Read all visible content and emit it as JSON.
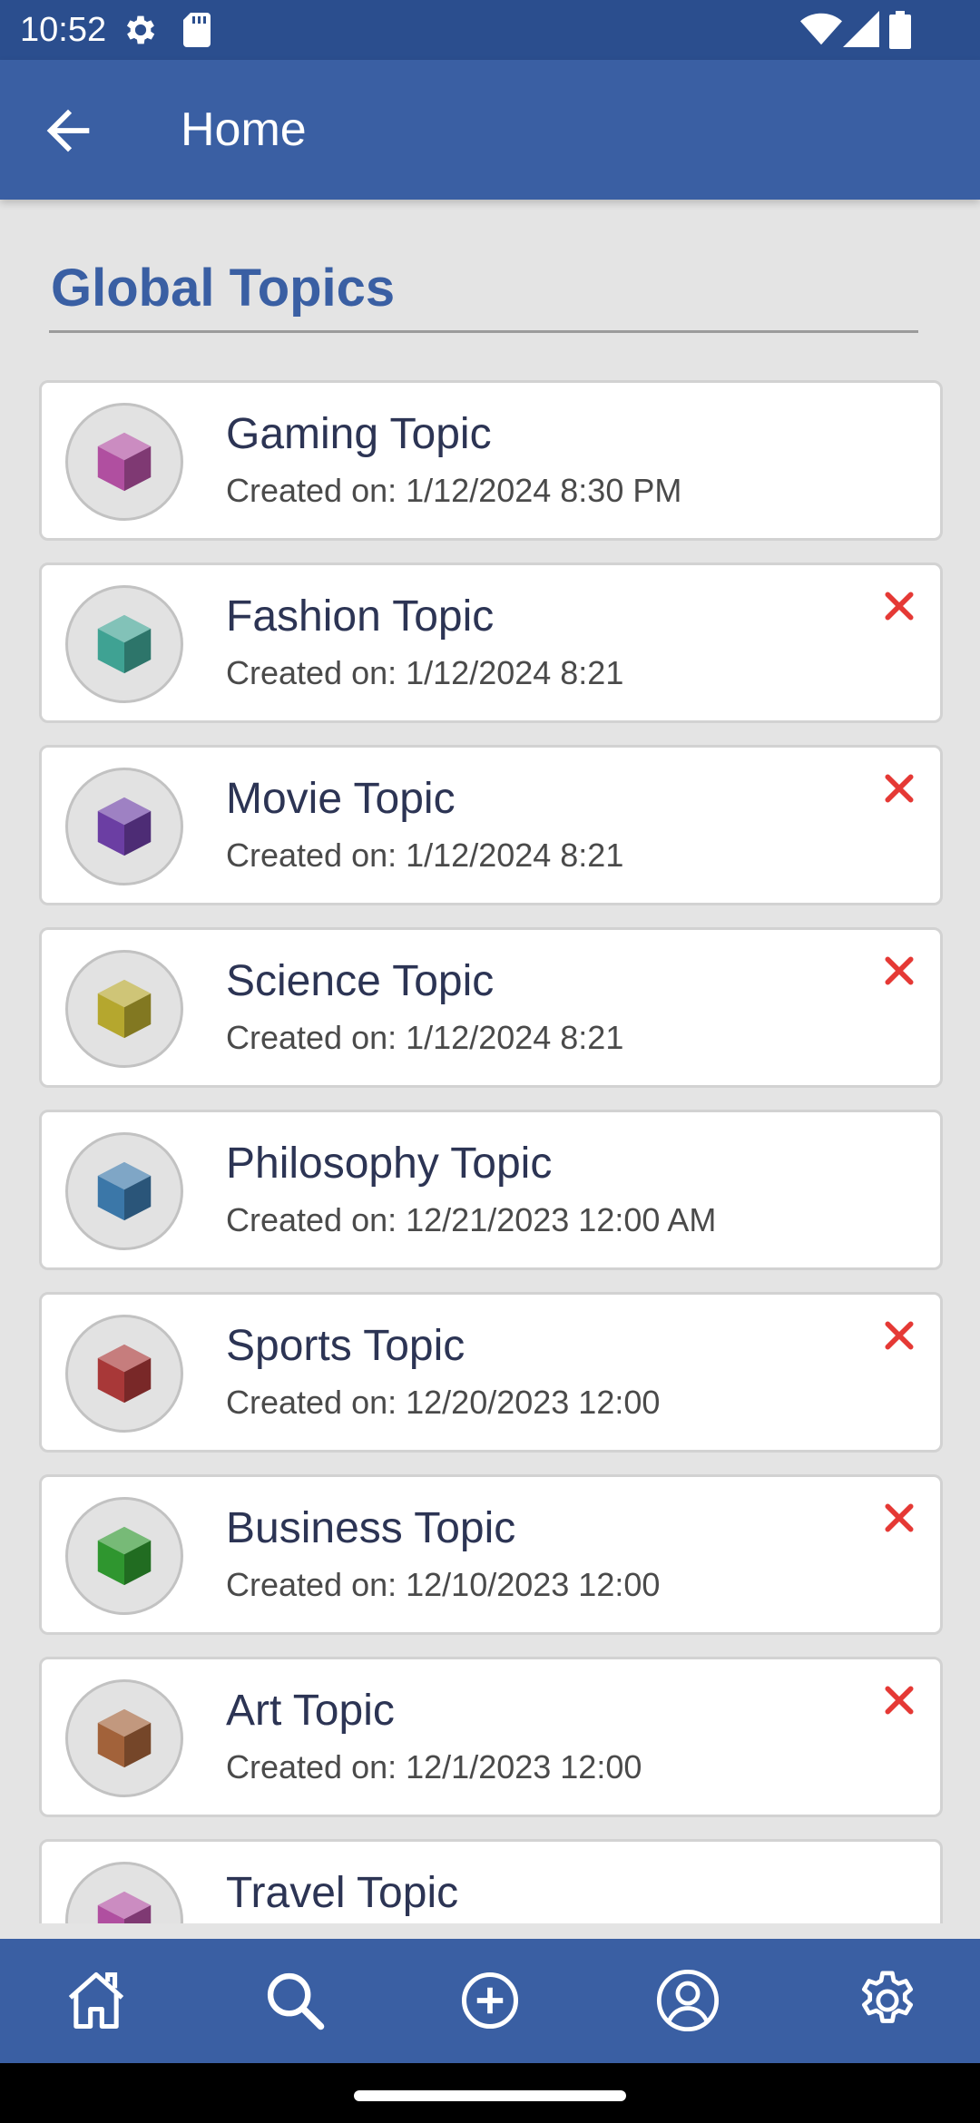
{
  "status_bar": {
    "time": "10:52",
    "icons": [
      "settings-gear-icon",
      "sd-card-icon",
      "wifi-icon",
      "signal-icon",
      "battery-icon"
    ]
  },
  "app_bar": {
    "title": "Home",
    "back_icon": "arrow-back-icon"
  },
  "section": {
    "title": "Global Topics"
  },
  "topics": [
    {
      "name": "Gaming Topic",
      "date": "Created on: 1/12/2024 8:30 PM",
      "color": "#b04fa0",
      "deletable": false
    },
    {
      "name": "Fashion Topic",
      "date": "Created on: 1/12/2024 8:21",
      "color": "#3fa293",
      "deletable": true
    },
    {
      "name": "Movie Topic",
      "date": "Created on: 1/12/2024 8:21",
      "color": "#6b3ea3",
      "deletable": true
    },
    {
      "name": "Science Topic",
      "date": "Created on: 1/12/2024 8:21",
      "color": "#b5a72e",
      "deletable": true
    },
    {
      "name": "Philosophy Topic",
      "date": "Created on: 12/21/2023 12:00 AM",
      "color": "#3b77a8",
      "deletable": false
    },
    {
      "name": "Sports Topic",
      "date": "Created on: 12/20/2023 12:00",
      "color": "#a83838",
      "deletable": true
    },
    {
      "name": "Business Topic",
      "date": "Created on: 12/10/2023 12:00",
      "color": "#2f962f",
      "deletable": true
    },
    {
      "name": "Art Topic",
      "date": "Created on: 12/1/2023 12:00",
      "color": "#a2623a",
      "deletable": true
    },
    {
      "name": "Travel Topic",
      "date": "",
      "color": "#b04fa0",
      "deletable": false
    }
  ],
  "bottom_nav": {
    "items": [
      "home-icon",
      "search-icon",
      "add-circle-icon",
      "profile-icon",
      "settings-icon"
    ]
  },
  "colors": {
    "primary": "#3a5fa3",
    "status_bar": "#2b4e8e",
    "delete": "#e53935",
    "background": "#e4e4e4"
  }
}
